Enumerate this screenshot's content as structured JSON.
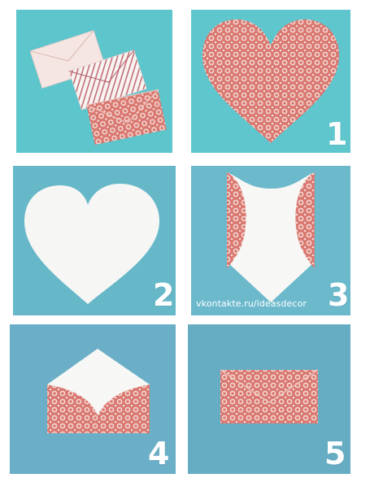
{
  "steps": [
    {
      "number": "1"
    },
    {
      "number": "2"
    },
    {
      "number": "3"
    },
    {
      "number": "4"
    },
    {
      "number": "5"
    }
  ],
  "watermark": "vkontakte.ru/ideasdecor",
  "colors": {
    "panel_teal": "#5fc6cd",
    "panel_blue": "#6ab0c6",
    "paper_white": "#f6f6f4",
    "pattern_red": "#d9776f",
    "pattern_light": "#f3d8d2"
  },
  "icons": {
    "number_style": "white-chalk-digits"
  }
}
